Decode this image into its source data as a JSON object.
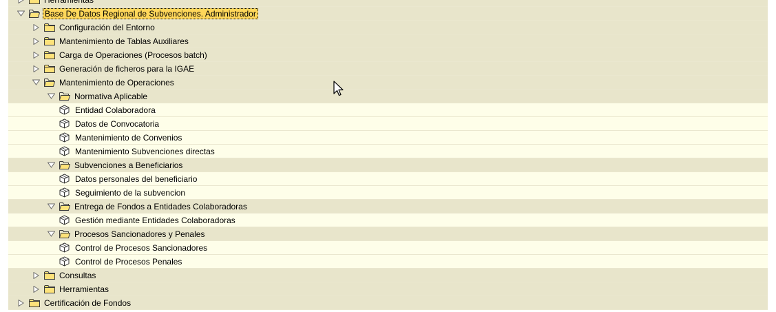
{
  "tree": {
    "nodes": [
      {
        "label": "Herramientas",
        "type": "folder",
        "level": 0,
        "expanded": false
      },
      {
        "label": "Base De Datos Regional de Subvenciones. Administrador",
        "type": "folder",
        "level": 0,
        "expanded": true,
        "focused": true
      },
      {
        "label": "Configuración del Entorno",
        "type": "folder",
        "level": 1,
        "expanded": false
      },
      {
        "label": "Mantenimiento de Tablas Auxiliares",
        "type": "folder",
        "level": 1,
        "expanded": false
      },
      {
        "label": "Carga de Operaciones (Procesos batch)",
        "type": "folder",
        "level": 1,
        "expanded": false
      },
      {
        "label": "Generación de ficheros para la IGAE",
        "type": "folder",
        "level": 1,
        "expanded": false
      },
      {
        "label": "Mantenimiento de Operaciones",
        "type": "folder",
        "level": 1,
        "expanded": true
      },
      {
        "label": "Normativa Aplicable",
        "type": "folder",
        "level": 2,
        "expanded": true
      },
      {
        "label": "Entidad Colaboradora",
        "type": "leaf",
        "level": 3
      },
      {
        "label": "Datos de Convocatoria",
        "type": "leaf",
        "level": 3
      },
      {
        "label": "Mantenimiento de Convenios",
        "type": "leaf",
        "level": 3
      },
      {
        "label": "Mantenimiento Subvenciones directas",
        "type": "leaf",
        "level": 3
      },
      {
        "label": "Subvenciones a Beneficiarios",
        "type": "folder",
        "level": 2,
        "expanded": true
      },
      {
        "label": "Datos personales del beneficiario",
        "type": "leaf",
        "level": 3
      },
      {
        "label": "Seguimiento de la subvencion",
        "type": "leaf",
        "level": 3
      },
      {
        "label": "Entrega de Fondos a Entidades Colaboradoras",
        "type": "folder",
        "level": 2,
        "expanded": true
      },
      {
        "label": "Gestión mediante Entidades Colaboradoras",
        "type": "leaf",
        "level": 3
      },
      {
        "label": "Procesos Sancionadores y Penales",
        "type": "folder",
        "level": 2,
        "expanded": true
      },
      {
        "label": "Control de Procesos Sancionadores",
        "type": "leaf",
        "level": 3
      },
      {
        "label": "Control de Procesos Penales",
        "type": "leaf",
        "level": 3
      },
      {
        "label": "Consultas",
        "type": "folder",
        "level": 1,
        "expanded": false
      },
      {
        "label": "Herramientas",
        "type": "folder",
        "level": 1,
        "expanded": false
      },
      {
        "label": "Certificación de Fondos",
        "type": "folder",
        "level": 0,
        "expanded": false
      }
    ]
  },
  "icons": {
    "expand": "expand-triangle-icon",
    "collapse": "collapse-triangle-icon",
    "folder_closed": "folder-closed-icon",
    "folder_open": "folder-open-icon",
    "transaction": "transaction-cube-icon",
    "cursor": "mouse-pointer-icon"
  },
  "colors": {
    "folder_row": "#e8e5cb",
    "leaf_row": "#fefee9",
    "focus_highlight": "#ffd75a",
    "folder_fill": "#fde27a"
  }
}
